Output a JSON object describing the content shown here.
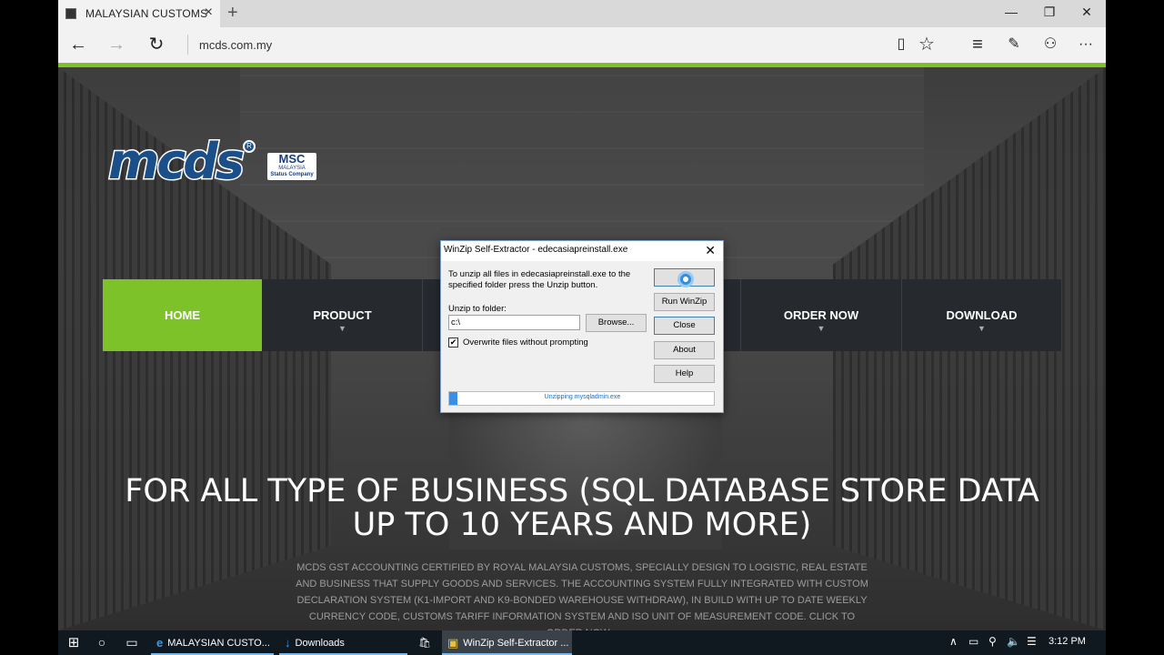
{
  "browser": {
    "tab_title": "MALAYSIAN CUSTOMS",
    "tab_close_icon": "×",
    "new_tab_icon": "+",
    "url": "mcds.com.my",
    "window_controls": {
      "minimize": "—",
      "restore": "❐",
      "close": "✕"
    },
    "nav": {
      "back": "←",
      "forward": "→",
      "refresh": "↻"
    },
    "toolbar": {
      "reading_view": "▯",
      "favorite": "☆",
      "hub": "≡",
      "note": "✎",
      "share": "⚇",
      "more": "···"
    },
    "accent_color": "#7cc228"
  },
  "site": {
    "logo_text": "mcds",
    "logo_reg": "R",
    "msc_logo": {
      "title": "MSC",
      "sub": "MALAYSIA",
      "status": "Status Company"
    },
    "menu": [
      {
        "label": "HOME",
        "active": true,
        "caret": ""
      },
      {
        "label": "PRODUCT",
        "active": false,
        "caret": "▼"
      },
      {
        "label": "ORDER NOW",
        "active": false,
        "caret": "▼"
      },
      {
        "label": "DOWNLOAD",
        "active": false,
        "caret": "▼"
      }
    ],
    "headline": "FOR ALL TYPE OF BUSINESS (SQL DATABASE STORE DATA UP TO 10 YEARS AND MORE)",
    "paragraph": "MCDS GST ACCOUNTING CERTIFIED BY ROYAL MALAYSIA CUSTOMS, SPECIALLY DESIGN TO LOGISTIC, REAL ESTATE AND BUSINESS THAT SUPPLY GOODS AND SERVICES. THE ACCOUNTING SYSTEM FULLY INTEGRATED WITH CUSTOM DECLARATION SYSTEM (K1-IMPORT AND K9-BONDED WAREHOUSE WITHDRAW), IN BUILD WITH UP TO DATE WEEKLY CURRENCY CODE, CUSTOMS TARIFF INFORMATION SYSTEM AND ISO UNIT OF MEASUREMENT CODE. CLICK TO ORDER NOW..."
  },
  "dialog": {
    "title": "WinZip Self-Extractor - edecasiapreinstall.exe",
    "close_icon": "✕",
    "message": "To unzip all files in edecasiapreinstall.exe to the specified folder press the Unzip button.",
    "folder_label": "Unzip to folder:",
    "folder_value": "c:\\",
    "browse": "Browse...",
    "overwrite_label": "Overwrite files without prompting",
    "overwrite_checked": "✔",
    "buttons": {
      "unzip": "",
      "run_winzip": "Run WinZip",
      "close": "Close",
      "about": "About",
      "help": "Help"
    },
    "progress_text": "Unzipping mysqladmin.exe",
    "progress": 0.03
  },
  "taskbar": {
    "start_icon": "⊞",
    "search_icon": "○",
    "task_view_icon": "▭",
    "apps": [
      {
        "icon": "e",
        "label": "MALAYSIAN CUSTO...",
        "active": false
      },
      {
        "icon": "↓",
        "label": "Downloads",
        "active": false
      },
      {
        "icon": "🛍",
        "label": "",
        "active": false
      },
      {
        "icon": "▣",
        "label": "WinZip Self-Extractor ...",
        "active": true
      }
    ],
    "tray": {
      "chevron": "∧",
      "battery": "▭",
      "network": "⚲",
      "volume": "🔈",
      "action_center": "☰"
    },
    "clock": "3:12 PM"
  }
}
